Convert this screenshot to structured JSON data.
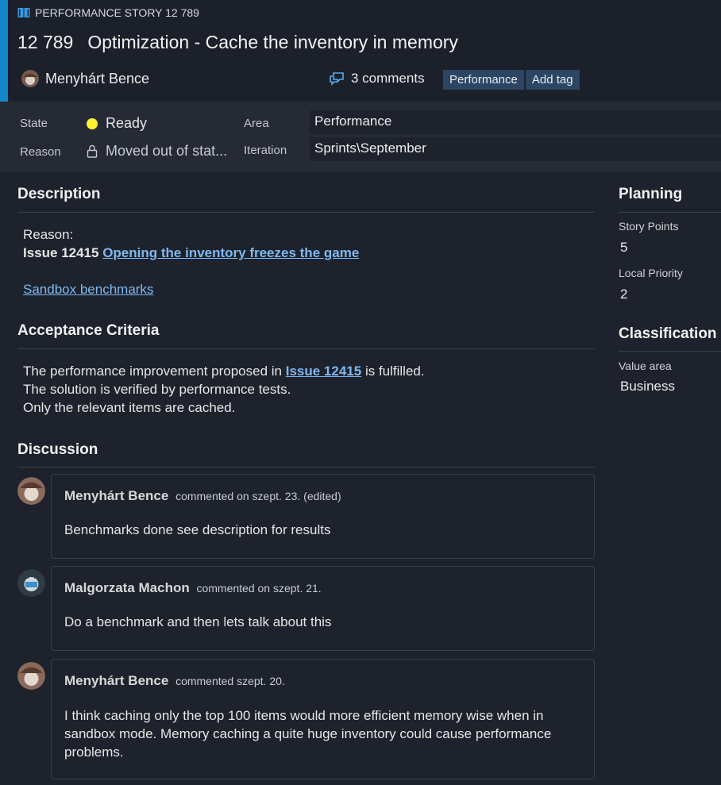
{
  "header": {
    "type_label": "PERFORMANCE STORY 12 789",
    "id": "12 789",
    "title": "Optimization - Cache the inventory in memory",
    "assignee": "Menyhárt Bence",
    "comments_label": "3 comments",
    "tags": [
      "Performance"
    ],
    "add_tag_label": "Add tag",
    "accent_color": "#1386c9"
  },
  "fields": {
    "state_label": "State",
    "state_value": "Ready",
    "state_color": "#fff033",
    "reason_label": "Reason",
    "reason_value": "Moved out of stat...",
    "area_label": "Area",
    "area_value": "Performance",
    "iteration_label": "Iteration",
    "iteration_value": "Sprints\\September"
  },
  "description": {
    "title": "Description",
    "reason_label": "Reason:",
    "issue_prefix": "Issue 12415",
    "issue_link": "Opening the inventory freezes the game",
    "sandbox_link": "Sandbox benchmarks"
  },
  "acceptance": {
    "title": "Acceptance Criteria",
    "line1_before": "The performance improvement proposed in",
    "line1_link": "Issue 12415",
    "line1_after": "is fulfilled.",
    "line2": "The solution is verified by performance tests.",
    "line3": "Only the relevant items are cached."
  },
  "discussion": {
    "title": "Discussion",
    "comments": [
      {
        "author": "Menyhárt Bence",
        "meta": "commented on szept. 23. (edited)",
        "body": "Benchmarks done see description for results"
      },
      {
        "author": "Malgorzata Machon",
        "meta": "commented on szept. 21.",
        "body": "Do a benchmark and then lets talk about this"
      },
      {
        "author": "Menyhárt Bence",
        "meta": "commented szept. 20.",
        "body": "I think caching only the top 100 items would more efficient memory wise when in sandbox mode. Memory caching a quite huge inventory could cause performance problems."
      }
    ]
  },
  "planning": {
    "title": "Planning",
    "story_points_label": "Story Points",
    "story_points_value": "5",
    "priority_label": "Local Priority",
    "priority_value": "2"
  },
  "classification": {
    "title": "Classification",
    "value_area_label": "Value area",
    "value_area_value": "Business"
  }
}
